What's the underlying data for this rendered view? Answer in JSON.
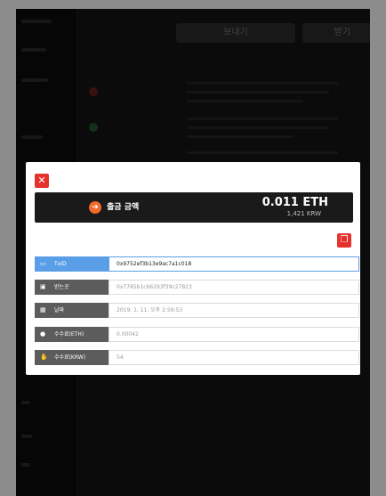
{
  "background": {
    "tab_send": "보내기",
    "tab_receive": "받기"
  },
  "modal": {
    "amount_label": "출금 금액",
    "amount_eth": "0.011 ETH",
    "amount_krw": "1,421 KRW",
    "fields": [
      {
        "label": "TxID",
        "value": "0x9752ef3b13e9ac7a1c018",
        "icon": "hash-icon",
        "active": true
      },
      {
        "label": "받는곳",
        "value": "0x7785b1c66293f39c27823",
        "icon": "wallet-icon",
        "active": false
      },
      {
        "label": "날짜",
        "value": "2019. 1. 11. 오후 2:59:53",
        "icon": "calendar-icon",
        "active": false
      },
      {
        "label": "수수료(ETH)",
        "value": "0.00042",
        "icon": "coin-icon",
        "active": false
      },
      {
        "label": "수수료(KRW)",
        "value": "54",
        "icon": "hand-coin-icon",
        "active": false
      }
    ]
  },
  "colors": {
    "close": "#e5322d",
    "accent": "#5b9ee8",
    "arrow": "#f26a2a"
  }
}
